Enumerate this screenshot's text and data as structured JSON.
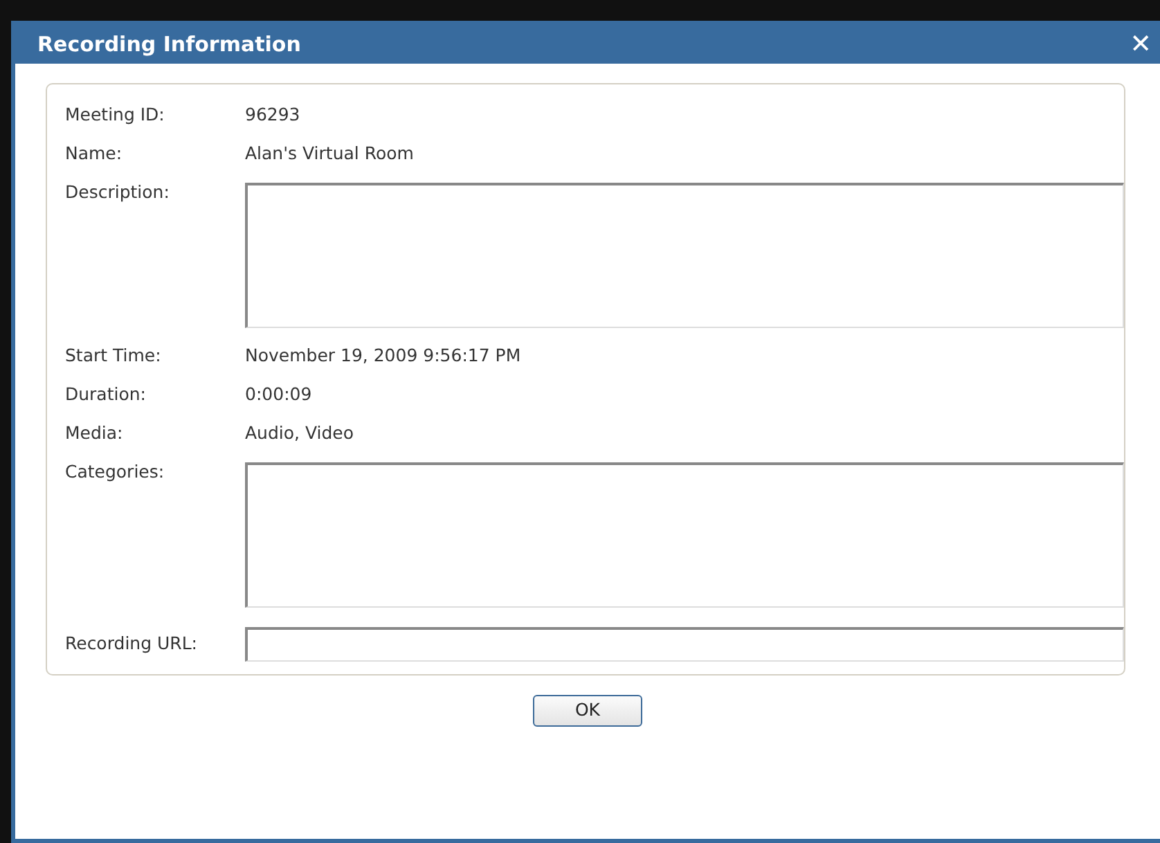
{
  "window": {
    "title": "Recording Information",
    "close": "✕"
  },
  "fields": [
    {
      "kind": "text",
      "label": "Meeting ID:",
      "value": "96293"
    },
    {
      "kind": "text",
      "label": "Name:",
      "value": "Alan's Virtual Room"
    },
    {
      "kind": "textarea",
      "label": "Description:"
    },
    {
      "kind": "text",
      "label": "Start Time:",
      "value": "November 19, 2009 9:56:17 PM"
    },
    {
      "kind": "text",
      "label": "Duration:",
      "value": "0:00:09"
    },
    {
      "kind": "text",
      "label": "Media:",
      "value": "Audio, Video"
    },
    {
      "kind": "textarea",
      "label": "Categories:"
    },
    {
      "kind": "input",
      "label": "Recording URL:"
    }
  ],
  "buttons": [
    "OK"
  ]
}
